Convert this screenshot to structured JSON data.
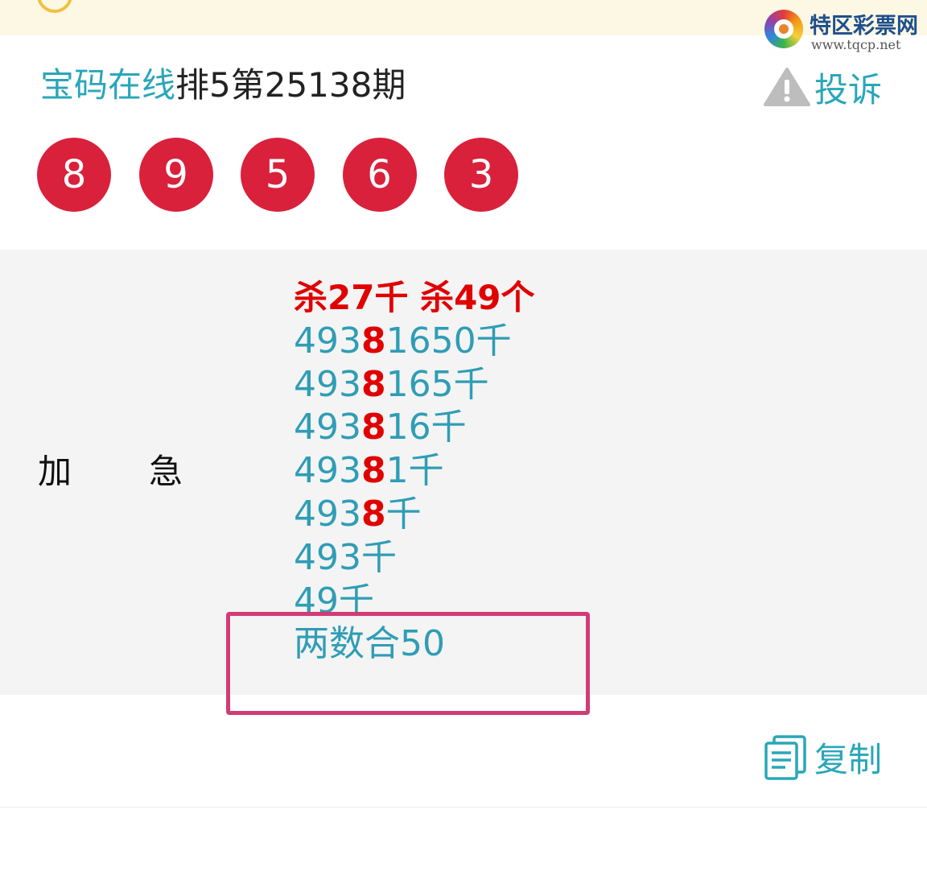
{
  "watermark": {
    "title": "特区彩票网",
    "url": "www.tqcp.net"
  },
  "header": {
    "brand": "宝码在线",
    "issue": "排5第25138期",
    "complain_label": "投诉"
  },
  "balls": [
    "8",
    "9",
    "5",
    "6",
    "3"
  ],
  "content": {
    "label_left": "加",
    "label_right": "急",
    "headline": "杀27千 杀49个",
    "rows": [
      {
        "pre": "493",
        "hl": "8",
        "post": "1650千"
      },
      {
        "pre": "493",
        "hl": "8",
        "post": "165千"
      },
      {
        "pre": "493",
        "hl": "8",
        "post": "16千"
      },
      {
        "pre": "493",
        "hl": "8",
        "post": "1千"
      },
      {
        "pre": "493",
        "hl": "8",
        "post": "千"
      },
      {
        "pre": "493千",
        "hl": "",
        "post": ""
      },
      {
        "pre": "49千",
        "hl": "",
        "post": ""
      }
    ],
    "extra": "两数合50"
  },
  "footer": {
    "copy_label": "复制"
  },
  "colors": {
    "brand": "#2aa6b9",
    "ball": "#d9213c",
    "highlight": "#e00000",
    "box": "#d23b76"
  }
}
